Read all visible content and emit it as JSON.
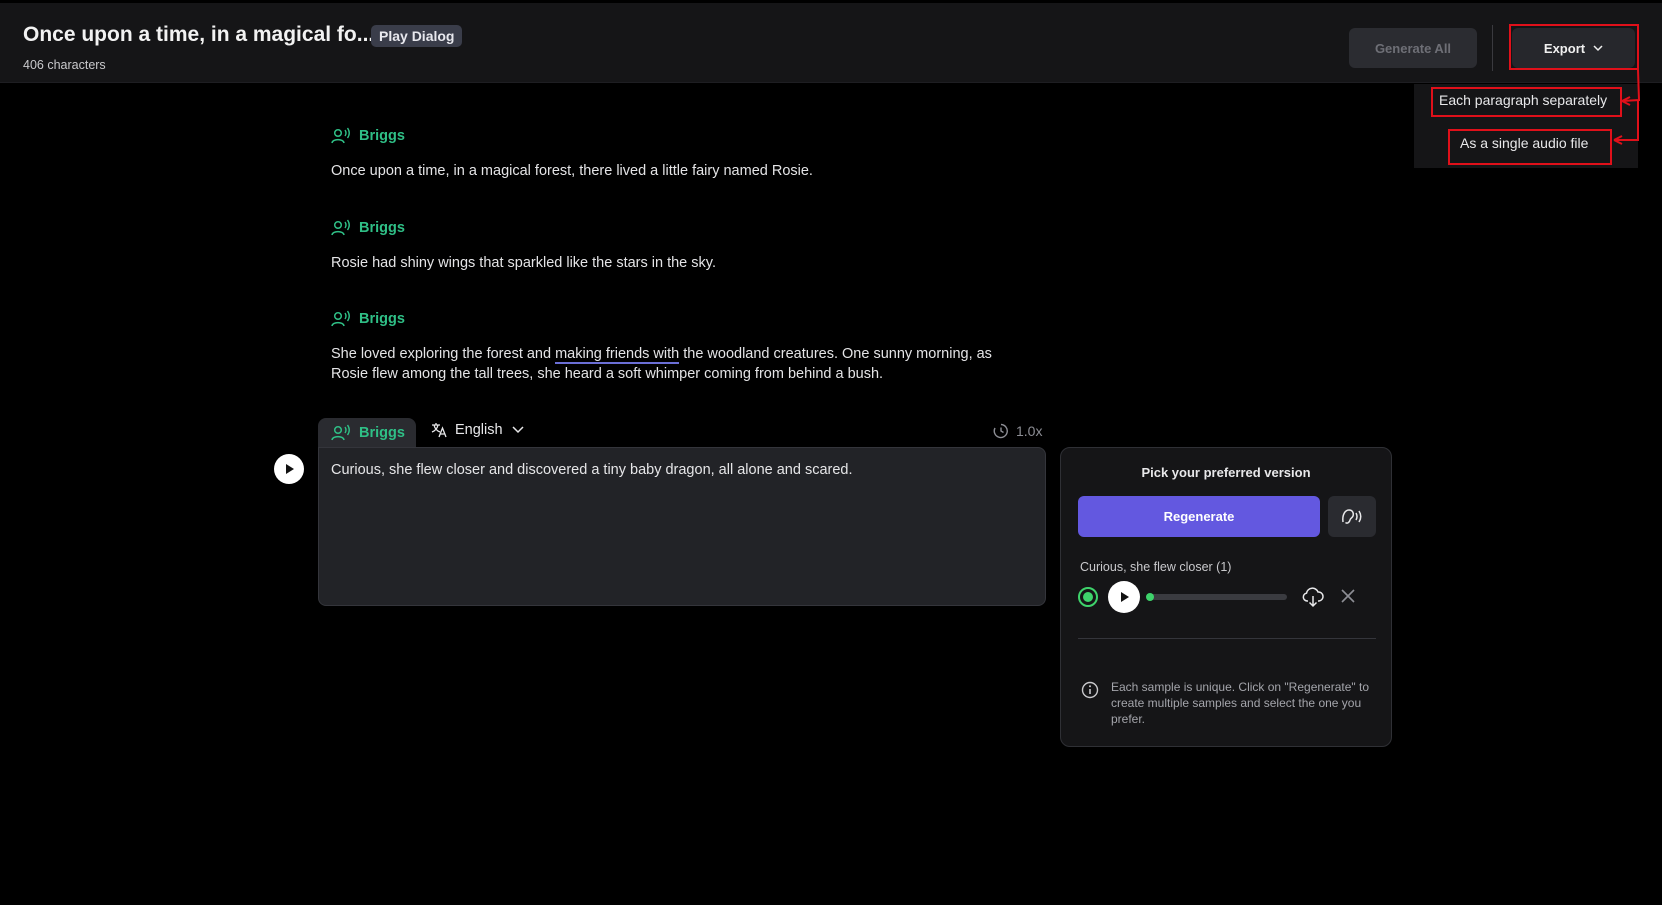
{
  "header": {
    "title": "Once upon a time, in a magical fo...",
    "badge": "Play Dialog",
    "char_count": "406 characters",
    "generate_all_label": "Generate All",
    "export_label": "Export"
  },
  "export_menu": {
    "items": [
      "Each paragraph separately",
      "As a single audio file"
    ]
  },
  "paragraphs": [
    {
      "speaker": "Briggs",
      "text": "Once upon a time, in a magical forest, there lived a little fairy named Rosie."
    },
    {
      "speaker": "Briggs",
      "text": "Rosie had shiny wings that sparkled like the stars in the sky."
    },
    {
      "speaker": "Briggs",
      "text_before": "She loved exploring the forest and ",
      "text_underlined": "making friends with",
      "text_after": " the woodland creatures. One sunny morning, as Rosie flew among the tall trees, she heard a soft whimper coming from behind a bush."
    }
  ],
  "editor": {
    "speaker": "Briggs",
    "language": "English",
    "speed": "1.0x",
    "text": "Curious, she flew closer and discovered a tiny baby dragon, all alone and scared."
  },
  "version_panel": {
    "title": "Pick your preferred version",
    "regenerate_label": "Regenerate",
    "sample_label": "Curious, she flew closer (1)",
    "playback_progress": 0,
    "info_text": "Each sample is unique. Click on \"Regenerate\" to create multiple samples and select the one you prefer."
  },
  "colors": {
    "accent_green": "#2fbf86",
    "regenerate_purple": "#6358e0",
    "highlight_red": "#e0101a"
  }
}
